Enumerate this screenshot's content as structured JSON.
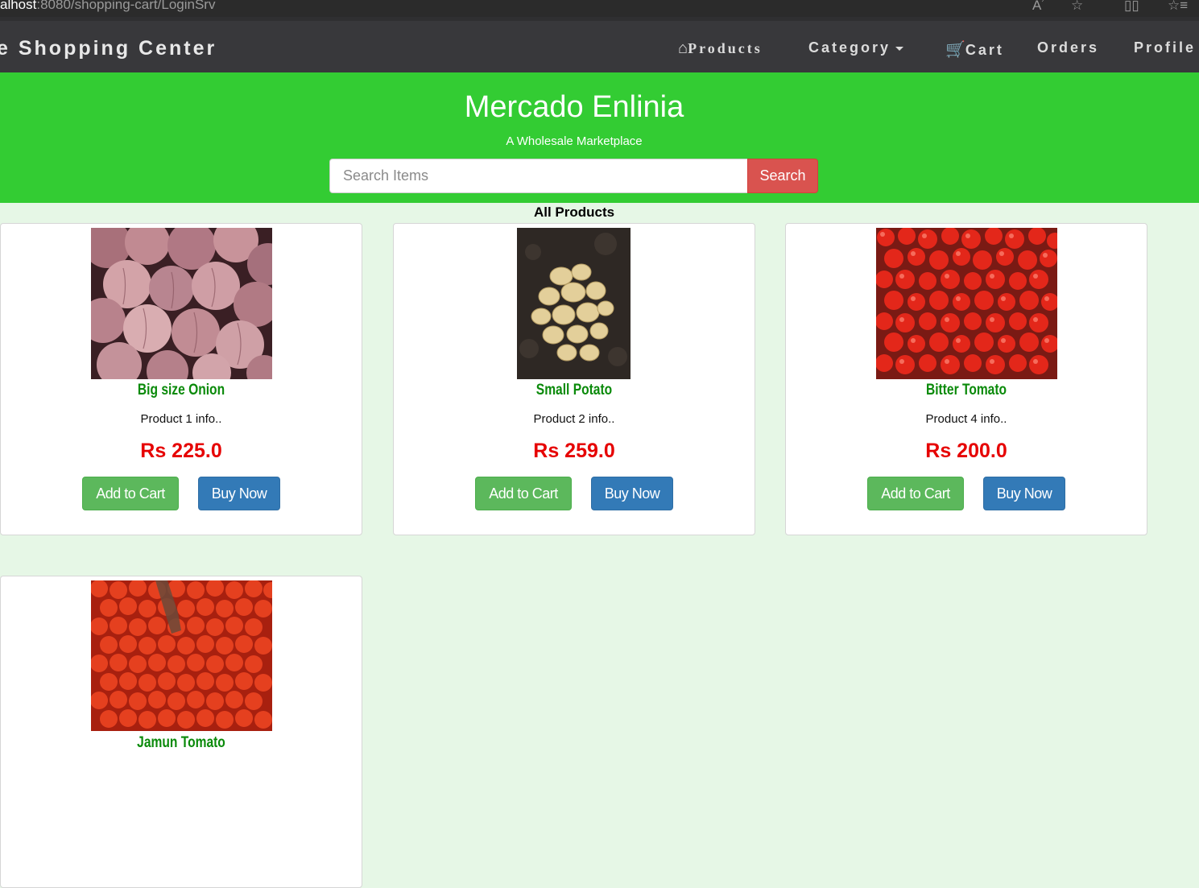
{
  "browser": {
    "url_host": "alhost",
    "url_path": ":8080/shopping-cart/LoginSrv",
    "icons": [
      "read-aloud-icon",
      "favorite-star-icon",
      "split-screen-icon",
      "favorites-list-icon"
    ]
  },
  "navbar": {
    "brand": "e Shopping Center",
    "items": {
      "products": "Products",
      "category": "Category",
      "cart": "Cart",
      "orders": "Orders",
      "profile": "Profile"
    }
  },
  "hero": {
    "title": "Mercado Enlinia",
    "tagline": "A Wholesale Marketplace",
    "search_placeholder": "Search Items",
    "search_button": "Search"
  },
  "section_title": "All Products",
  "products": [
    {
      "name": "Big size Onion",
      "info": "Product 1 info..",
      "price": "Rs 225.0",
      "add": "Add to Cart",
      "buy": "Buy Now"
    },
    {
      "name": "Small Potato",
      "info": "Product 2 info..",
      "price": "Rs 259.0",
      "add": "Add to Cart",
      "buy": "Buy Now"
    },
    {
      "name": "Bitter Tomato",
      "info": "Product 4 info..",
      "price": "Rs 200.0",
      "add": "Add to Cart",
      "buy": "Buy Now"
    },
    {
      "name": "Jamun Tomato"
    }
  ],
  "colors": {
    "hero": "#33cc33",
    "navbar": "#38383b",
    "page_bg": "#e6f7e6",
    "product_name": "#0a8a0a",
    "price": "#e60000",
    "add_to_cart": "#5cb85c",
    "buy_now": "#337ab7",
    "search_button": "#d9534f"
  }
}
